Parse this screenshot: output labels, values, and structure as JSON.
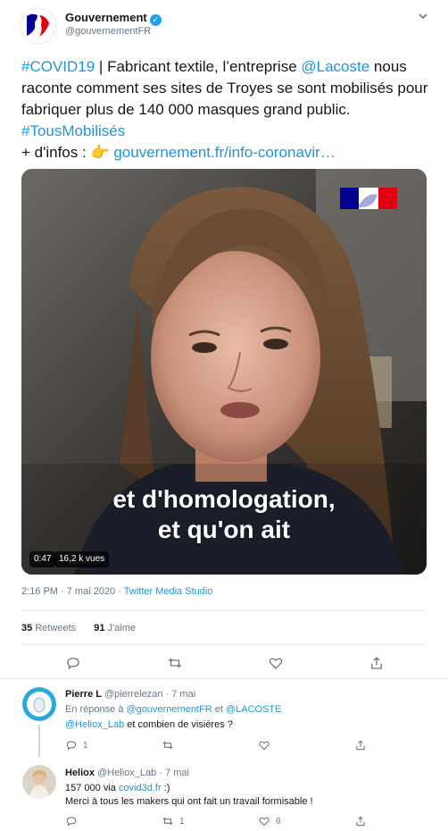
{
  "tweet": {
    "author_name": "Gouvernement",
    "author_handle": "@gouvernementFR",
    "text": {
      "hashtag1": "#COVID19",
      "part1": " | Fabricant textile, l’entreprise ",
      "mention": "@Lacoste",
      "part2": " nous raconte comment ses sites de Troyes se sont mobilisés pour fabriquer plus de 140 000 masques grand public. ",
      "hashtag2": "#TousMobilisés",
      "part3": "+ d'infos : ",
      "emoji": "👉",
      "link": "gouvernement.fr/info-coronavir…"
    },
    "video": {
      "subtitle_line1": "et d'homologation,",
      "subtitle_line2": "et qu'on ait",
      "duration": "0:47",
      "views": "16,2 k vues"
    },
    "time": "2:16 PM",
    "date": "7 mai 2020",
    "source": "Twitter Media Studio",
    "retweets_count": "35",
    "retweets_label": "Retweets",
    "likes_count": "91",
    "likes_label": "J'aime"
  },
  "replies": [
    {
      "name": "Pierre L",
      "handle": "@pierrelezan",
      "date": "7 mai",
      "reply_to_label": "En réponse à",
      "reply_to_1": "@gouvernementFR",
      "reply_to_and": "et",
      "reply_to_2": "@LACOSTE",
      "mention": "@Heliox_Lab",
      "text": " et combien de visières ?",
      "reply_count": "1",
      "retweet_count": "",
      "like_count": ""
    },
    {
      "name": "Heliox",
      "handle": "@Heliox_Lab",
      "date": "7 mai",
      "line1_prefix": "157 000 via ",
      "line1_link": "covid3d.fr",
      "line1_suffix": " :)",
      "line2": "Merci à tous les makers qui ont fait un travail formisable !",
      "reply_count": "",
      "retweet_count": "1",
      "like_count": "6"
    }
  ],
  "colors": {
    "accent": "#1da1f2",
    "link": "#1b95e0",
    "muted": "#657786",
    "flag_blue": "#000091",
    "flag_red": "#e1000f"
  }
}
